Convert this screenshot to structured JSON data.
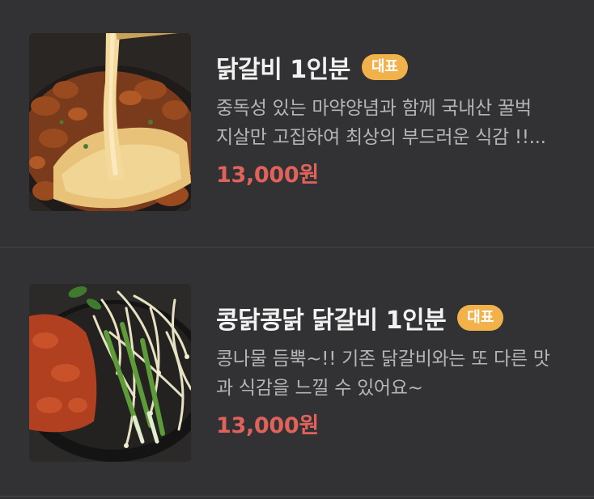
{
  "menu": {
    "items": [
      {
        "title": "닭갈비 1인분",
        "badge": "대표",
        "desc_line1": "중독성 있는 마약양념과 함께 국내산 꿀벅",
        "desc_line2": "지살만 고집하여 최상의 부드러운 식감 !!...",
        "price": "13,000원",
        "image_icon": "cheese-dakgalbi-photo"
      },
      {
        "title": "콩닭콩닭 닭갈비 1인분",
        "badge": "대표",
        "desc_line1": "콩나물 듬뿍~!! 기존 닭갈비와는 또 다른 맛",
        "desc_line2": "과 식감을 느낄 수 있어요~",
        "price": "13,000원",
        "image_icon": "bean-sprout-dakgalbi-photo"
      }
    ]
  },
  "colors": {
    "background": "#323234",
    "badge": "#f2b24b",
    "price": "#e0625a",
    "title": "#f2f2f2",
    "description": "#b5b5b7"
  }
}
